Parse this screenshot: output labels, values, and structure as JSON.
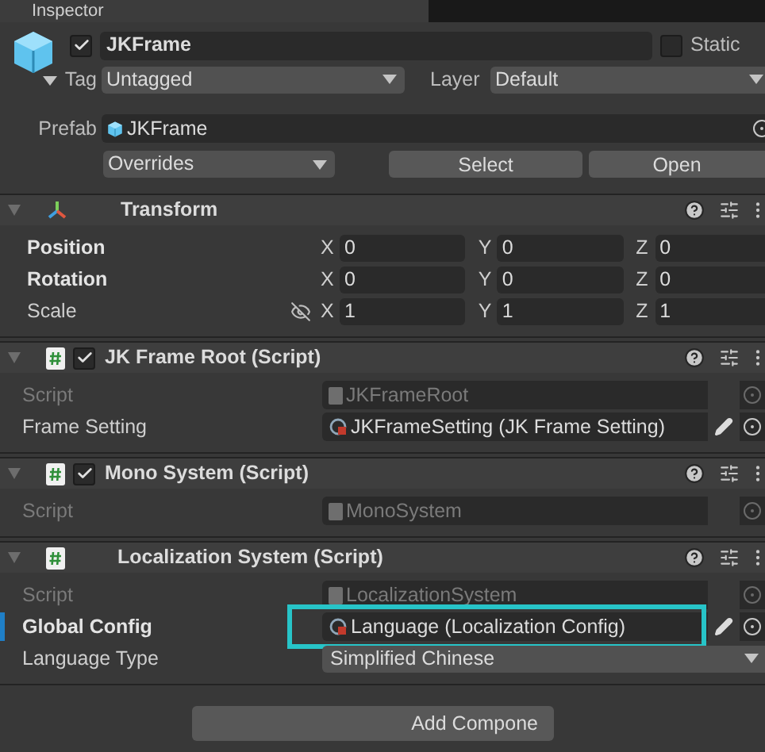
{
  "tab": {
    "title": "Inspector"
  },
  "object": {
    "active": true,
    "name": "JKFrame",
    "static": false,
    "static_label": "Static",
    "tag_label": "Tag",
    "tag": "Untagged",
    "layer_label": "Layer",
    "layer": "Default"
  },
  "prefab": {
    "label": "Prefab",
    "value": "JKFrame",
    "overrides": "Overrides",
    "buttons": [
      "Select",
      "Open"
    ]
  },
  "components": [
    {
      "kind": "transform",
      "title": "Transform",
      "expanded": true,
      "rows": [
        {
          "label": "Position",
          "overridden": true,
          "linked_icon": false,
          "axes": [
            {
              "axis": "X",
              "value": "0"
            },
            {
              "axis": "Y",
              "value": "0"
            },
            {
              "axis": "Z",
              "value": "0"
            }
          ]
        },
        {
          "label": "Rotation",
          "overridden": true,
          "linked_icon": false,
          "axes": [
            {
              "axis": "X",
              "value": "0"
            },
            {
              "axis": "Y",
              "value": "0"
            },
            {
              "axis": "Z",
              "value": "0"
            }
          ]
        },
        {
          "label": "Scale",
          "overridden": false,
          "linked_icon": true,
          "axes": [
            {
              "axis": "X",
              "value": "1"
            },
            {
              "axis": "Y",
              "value": "1"
            },
            {
              "axis": "Z",
              "value": "1"
            }
          ]
        }
      ]
    },
    {
      "kind": "script",
      "title": "JK Frame Root (Script)",
      "expanded": true,
      "has_toggle": true,
      "enabled": true,
      "fields": [
        {
          "kind": "script_ref",
          "label": "Script",
          "value": "JKFrameRoot",
          "overridden": false,
          "highlighted": false
        },
        {
          "kind": "object_ref",
          "label": "Frame Setting",
          "value": "JKFrameSetting (JK Frame Setting)",
          "overridden": false,
          "highlighted": false
        }
      ]
    },
    {
      "kind": "script",
      "title": "Mono System (Script)",
      "expanded": true,
      "has_toggle": true,
      "enabled": true,
      "fields": [
        {
          "kind": "script_ref",
          "label": "Script",
          "value": "MonoSystem",
          "overridden": false,
          "highlighted": false
        }
      ]
    },
    {
      "kind": "script",
      "title": "Localization System (Script)",
      "expanded": true,
      "has_toggle": false,
      "fields": [
        {
          "kind": "script_ref",
          "label": "Script",
          "value": "LocalizationSystem",
          "overridden": false,
          "highlighted": false
        },
        {
          "kind": "object_ref",
          "label": "Global Config",
          "value": "Language (Localization Config)",
          "overridden": true,
          "highlighted": true
        },
        {
          "kind": "enum",
          "label": "Language Type",
          "value": "Simplified Chinese",
          "overridden": false,
          "highlighted": false
        }
      ]
    }
  ],
  "add_component": "Add Compone"
}
